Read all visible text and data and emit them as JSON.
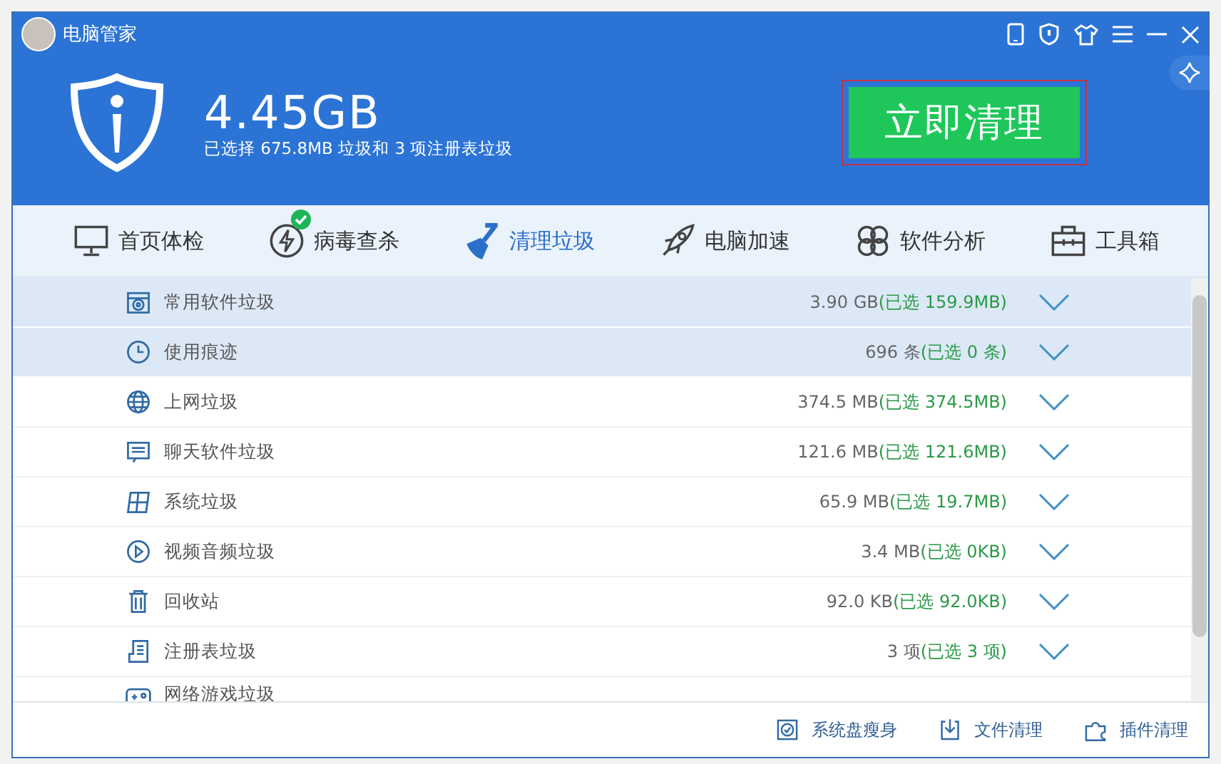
{
  "window": {
    "title": "电脑管家"
  },
  "summary": {
    "amount": "4.45GB",
    "detail": "已选择 675.8MB 垃圾和 3 项注册表垃圾",
    "action": "立即清理"
  },
  "tabs": [
    {
      "label": "首页体检",
      "kind": "monitor",
      "selected": false,
      "badge": false
    },
    {
      "label": "病毒查杀",
      "kind": "bolt",
      "selected": false,
      "badge": true
    },
    {
      "label": "清理垃圾",
      "kind": "broom",
      "selected": true,
      "badge": false
    },
    {
      "label": "电脑加速",
      "kind": "rocket",
      "selected": false,
      "badge": false
    },
    {
      "label": "软件分析",
      "kind": "clover",
      "selected": false,
      "badge": false
    },
    {
      "label": "工具箱",
      "kind": "toolbox",
      "selected": false,
      "badge": false
    }
  ],
  "items": [
    {
      "kind": "disk",
      "name": "常用软件垃圾",
      "total": "3.90 GB",
      "chosen": "(已选 159.9MB)",
      "highlighted": true
    },
    {
      "kind": "clock",
      "name": "使用痕迹",
      "total": "696 条",
      "chosen": "(已选 0 条)",
      "highlighted": true
    },
    {
      "kind": "globe",
      "name": "上网垃圾",
      "total": "374.5 MB",
      "chosen": "(已选 374.5MB)",
      "highlighted": false
    },
    {
      "kind": "chat",
      "name": "聊天软件垃圾",
      "total": "121.6 MB",
      "chosen": "(已选 121.6MB)",
      "highlighted": false
    },
    {
      "kind": "windows",
      "name": "系统垃圾",
      "total": "65.9 MB",
      "chosen": "(已选 19.7MB)",
      "highlighted": false
    },
    {
      "kind": "play",
      "name": "视频音频垃圾",
      "total": "3.4 MB",
      "chosen": "(已选 0KB)",
      "highlighted": false
    },
    {
      "kind": "trash",
      "name": "回收站",
      "total": "92.0 KB",
      "chosen": "(已选 92.0KB)",
      "highlighted": false
    },
    {
      "kind": "doc",
      "name": "注册表垃圾",
      "total": "3 项",
      "chosen": "(已选 3 项)",
      "highlighted": false
    },
    {
      "kind": "game",
      "name": "网络游戏垃圾",
      "highlighted": false
    }
  ],
  "footer_links": [
    {
      "kind": "disk-check",
      "label": "系统盘瘦身"
    },
    {
      "kind": "download",
      "label": "文件清理"
    },
    {
      "kind": "puzzle",
      "label": "插件清理"
    }
  ]
}
